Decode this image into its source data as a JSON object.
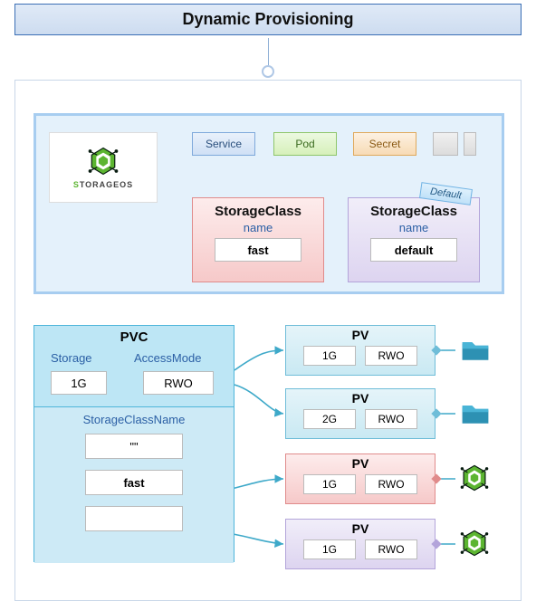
{
  "title": "Dynamic Provisioning",
  "logo": {
    "prefix": "S",
    "rest": "TORAGEOS"
  },
  "resources": {
    "service": "Service",
    "pod": "Pod",
    "secret": "Secret"
  },
  "default_badge": "Default",
  "storage_classes": [
    {
      "title": "StorageClass",
      "label": "name",
      "value": "fast"
    },
    {
      "title": "StorageClass",
      "label": "name",
      "value": "default"
    }
  ],
  "pvc": {
    "title": "PVC",
    "storage_label": "Storage",
    "access_label": "AccessMode",
    "storage_value": "1G",
    "access_value": "RWO",
    "scn_label": "StorageClassName",
    "scn_values": [
      "\"\"",
      "fast",
      ""
    ]
  },
  "pvs": [
    {
      "title": "PV",
      "size": "1G",
      "mode": "RWO"
    },
    {
      "title": "PV",
      "size": "2G",
      "mode": "RWO"
    },
    {
      "title": "PV",
      "size": "1G",
      "mode": "RWO"
    },
    {
      "title": "PV",
      "size": "1G",
      "mode": "RWO"
    }
  ]
}
